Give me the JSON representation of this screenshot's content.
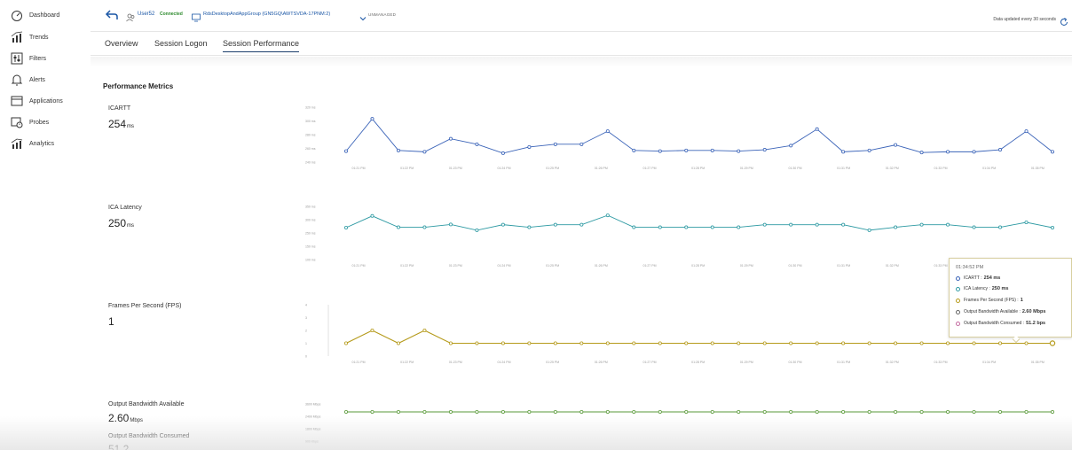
{
  "sidebar": {
    "items": [
      {
        "label": "Dashboard",
        "icon": "dashboard-icon"
      },
      {
        "label": "Trends",
        "icon": "trends-icon"
      },
      {
        "label": "Filters",
        "icon": "filters-icon"
      },
      {
        "label": "Alerts",
        "icon": "bell-icon"
      },
      {
        "label": "Applications",
        "icon": "applications-icon"
      },
      {
        "label": "Probes",
        "icon": "probes-icon"
      },
      {
        "label": "Analytics",
        "icon": "analytics-icon"
      }
    ]
  },
  "header": {
    "user": "User52",
    "status": "Connected",
    "machine": "RdsDesktopAndAppGroup (GN5GQ\\AWTSVDA-17PNM:2)",
    "management": "UNMANAGED",
    "update_note": "Data updated every 30 seconds"
  },
  "tabs": [
    {
      "label": "Overview"
    },
    {
      "label": "Session Logon"
    },
    {
      "label": "Session Performance",
      "active": true
    }
  ],
  "section_title": "Performance Metrics",
  "colors": {
    "icartt": "#3a63b8",
    "ica_latency": "#2e9aa3",
    "fps": "#b59a1a",
    "bandwidth": "#5a9a3a",
    "accent": "#1a56a5",
    "connected": "#2e8b2e"
  },
  "metrics": {
    "icartt": {
      "name": "ICARTT",
      "value": "254",
      "unit": "ms"
    },
    "ica_latency": {
      "name": "ICA Latency",
      "value": "250",
      "unit": "ms"
    },
    "fps": {
      "name": "Frames Per Second (FPS)",
      "value": "1",
      "unit": ""
    },
    "bw_available": {
      "name": "Output Bandwidth Available",
      "value": "2.60",
      "unit": "Mbps"
    },
    "bw_consumed": {
      "name": "Output Bandwidth Consumed",
      "value": "51.2",
      "unit": ""
    }
  },
  "tooltip": {
    "time": "01:34:52 PM",
    "rows": [
      {
        "label": "ICARTT :",
        "value": "254 ms",
        "color": "#3a63b8"
      },
      {
        "label": "ICA Latency :",
        "value": "250 ms",
        "color": "#2e9aa3"
      },
      {
        "label": "Frames Per Second (FPS) :",
        "value": "1",
        "color": "#b59a1a"
      },
      {
        "label": "Output Bandwidth Available :",
        "value": "2.60 Mbps",
        "color": "#666666"
      },
      {
        "label": "Output Bandwidth Consumed :",
        "value": "51.2 bps",
        "color": "#c46aa0"
      }
    ]
  },
  "chart_data": [
    {
      "type": "line",
      "name": "ICARTT",
      "y_ticks": [
        "320 ms",
        "300 ms",
        "280 ms",
        "260 ms",
        "240 ms"
      ],
      "ylim": [
        240,
        320
      ],
      "x_ticks": [
        "01:21 PM",
        "01:22 PM",
        "01:23 PM",
        "01:24 PM",
        "01:25 PM",
        "01:26 PM",
        "01:27 PM",
        "01:28 PM",
        "01:29 PM",
        "01:30 PM",
        "01:31 PM",
        "01:32 PM",
        "01:33 PM",
        "01:34 PM",
        "01:35 PM"
      ],
      "values": [
        256,
        303,
        257,
        255,
        274,
        266,
        253,
        262,
        266,
        266,
        285,
        257,
        256,
        257,
        257,
        256,
        258,
        264,
        288,
        255,
        257,
        265,
        254,
        255,
        255,
        258,
        285,
        255
      ]
    },
    {
      "type": "line",
      "name": "ICA Latency",
      "y_ticks": [
        "350 ms",
        "300 ms",
        "250 ms",
        "150 ms",
        "100 ms"
      ],
      "ylim": [
        100,
        350
      ],
      "x_ticks": [
        "01:21 PM",
        "01:22 PM",
        "01:23 PM",
        "01:24 PM",
        "01:25 PM",
        "01:26 PM",
        "01:27 PM",
        "01:28 PM",
        "01:29 PM",
        "01:30 PM",
        "01:31 PM",
        "01:32 PM",
        "01:33 PM"
      ],
      "values": [
        250,
        305,
        252,
        252,
        265,
        238,
        264,
        252,
        264,
        264,
        308,
        252,
        252,
        252,
        252,
        252,
        264,
        264,
        264,
        264,
        238,
        252,
        264,
        264,
        252,
        252,
        275,
        250
      ]
    },
    {
      "type": "line",
      "name": "Frames Per Second (FPS)",
      "y_ticks": [
        "4",
        "3",
        "2",
        "1",
        "0"
      ],
      "ylim": [
        0,
        4
      ],
      "x_ticks": [
        "01:21 PM",
        "01:22 PM",
        "01:23 PM",
        "01:24 PM",
        "01:25 PM",
        "01:26 PM",
        "01:27 PM",
        "01:28 PM",
        "01:29 PM",
        "01:30 PM",
        "01:31 PM",
        "01:32 PM",
        "01:33 PM",
        "01:34 PM",
        "01:35 PM"
      ],
      "values": [
        1,
        2,
        1,
        2,
        1,
        1,
        1,
        1,
        1,
        1,
        1,
        1,
        1,
        1,
        1,
        1,
        1,
        1,
        1,
        1,
        1,
        1,
        1,
        1,
        1,
        1,
        1,
        1
      ]
    },
    {
      "type": "line",
      "name": "Output Bandwidth Available",
      "y_ticks": [
        "3600 Mbps",
        "2400 Mbps",
        "1800 Mbps",
        "900 Kbps"
      ],
      "values": [
        2.6,
        2.6,
        2.6,
        2.6,
        2.6,
        2.6,
        2.6,
        2.6,
        2.6,
        2.6,
        2.6,
        2.6,
        2.6,
        2.6,
        2.6,
        2.6,
        2.6,
        2.6,
        2.6,
        2.6,
        2.6,
        2.6,
        2.6,
        2.6,
        2.6,
        2.6,
        2.6,
        2.6
      ]
    }
  ]
}
